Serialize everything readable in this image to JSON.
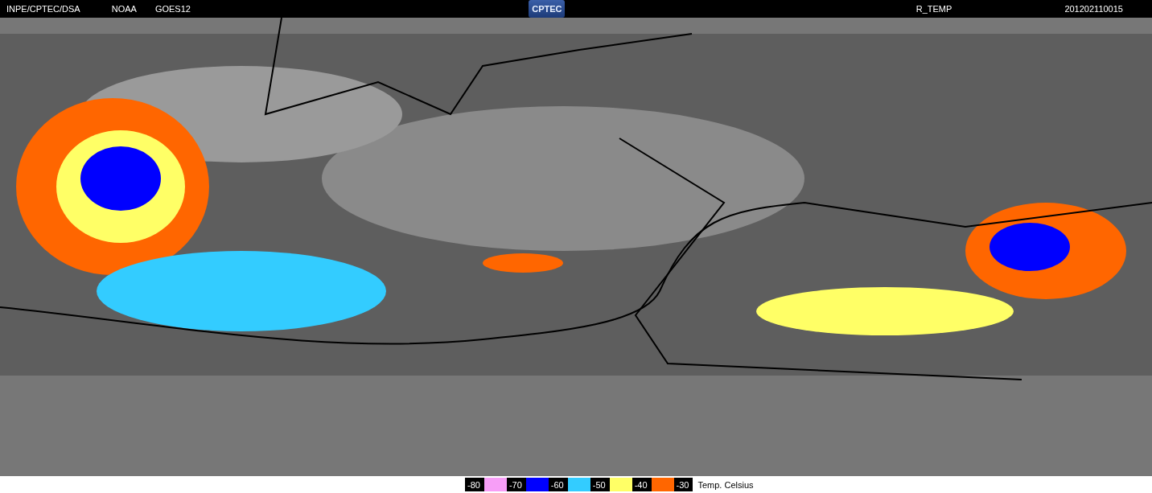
{
  "header": {
    "source": "INPE/CPTEC/DSA",
    "agency": "NOAA",
    "satellite": "GOES12",
    "logo": "CPTEC",
    "product": "R_TEMP",
    "timestamp": "201202110015"
  },
  "legend": {
    "items": [
      {
        "label": "-80",
        "color": "#f79ef7"
      },
      {
        "label": "-70",
        "color": "#0000ff"
      },
      {
        "label": "-60",
        "color": "#33ccff"
      },
      {
        "label": "-50",
        "color": "#ffff66"
      },
      {
        "label": "-40",
        "color": "#ff6600"
      },
      {
        "label": "-30"
      }
    ],
    "unit": "Temp. Celsius"
  }
}
